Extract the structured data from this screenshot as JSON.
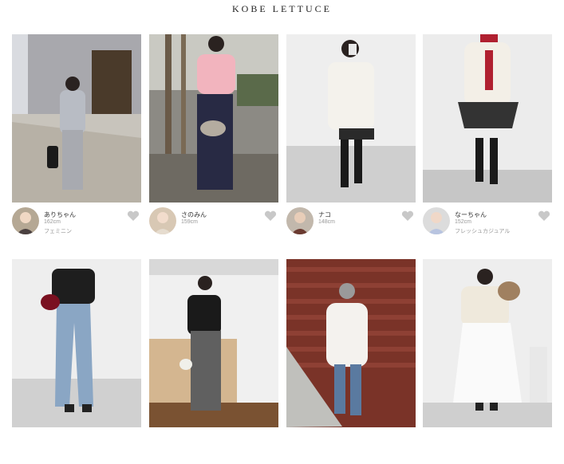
{
  "brand": "KOBE LETTUCE",
  "icons": {
    "like": "heart-icon"
  },
  "accent": {
    "heart": "#c8c8c8",
    "text_muted": "#999999"
  },
  "posts": [
    {
      "name": "ありちゃん",
      "height": "162cm",
      "style": "フェミニン"
    },
    {
      "name": "さのみん",
      "height": "159cm",
      "style": ""
    },
    {
      "name": "ナコ",
      "height": "148cm",
      "style": ""
    },
    {
      "name": "なーちゃん",
      "height": "152cm",
      "style": "フレッシュカジュアル"
    },
    {
      "name": "",
      "height": "",
      "style": ""
    },
    {
      "name": "",
      "height": "",
      "style": ""
    },
    {
      "name": "",
      "height": "",
      "style": ""
    },
    {
      "name": "",
      "height": "",
      "style": ""
    }
  ]
}
